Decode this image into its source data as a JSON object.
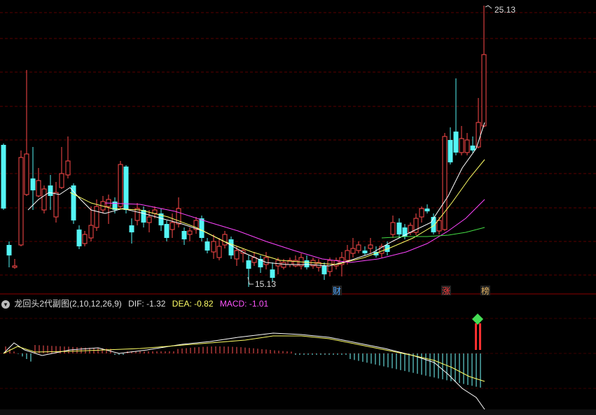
{
  "main_panel": {
    "header_visible": "...",
    "high_label": "25.13",
    "low_label": "15.13",
    "markers": [
      {
        "text": "财",
        "color": "#4aa3ff"
      },
      {
        "text": "涨",
        "color": "#ff3b3b"
      },
      {
        "text": "榜",
        "color": "#e0b060"
      }
    ]
  },
  "sub_panel": {
    "title": "龙回头2代副图(2,10,12,26,9)",
    "dif_label": "DIF: -1.32",
    "dea_label": "DEA: -0.82",
    "macd_label": "MACD: -1.01",
    "colors": {
      "dif": "#ffffff",
      "dea": "#ffff66",
      "macd": "#ff55ff"
    }
  },
  "chart_data": {
    "type": "candlestick",
    "price_range": [
      15.13,
      25.13
    ],
    "annotations": [
      "25.13",
      "15.13"
    ],
    "indicator": {
      "name": "MACD",
      "params": [
        2,
        10,
        12,
        26,
        9
      ],
      "DIF": -1.32,
      "DEA": -0.82,
      "MACD": -1.01
    }
  }
}
